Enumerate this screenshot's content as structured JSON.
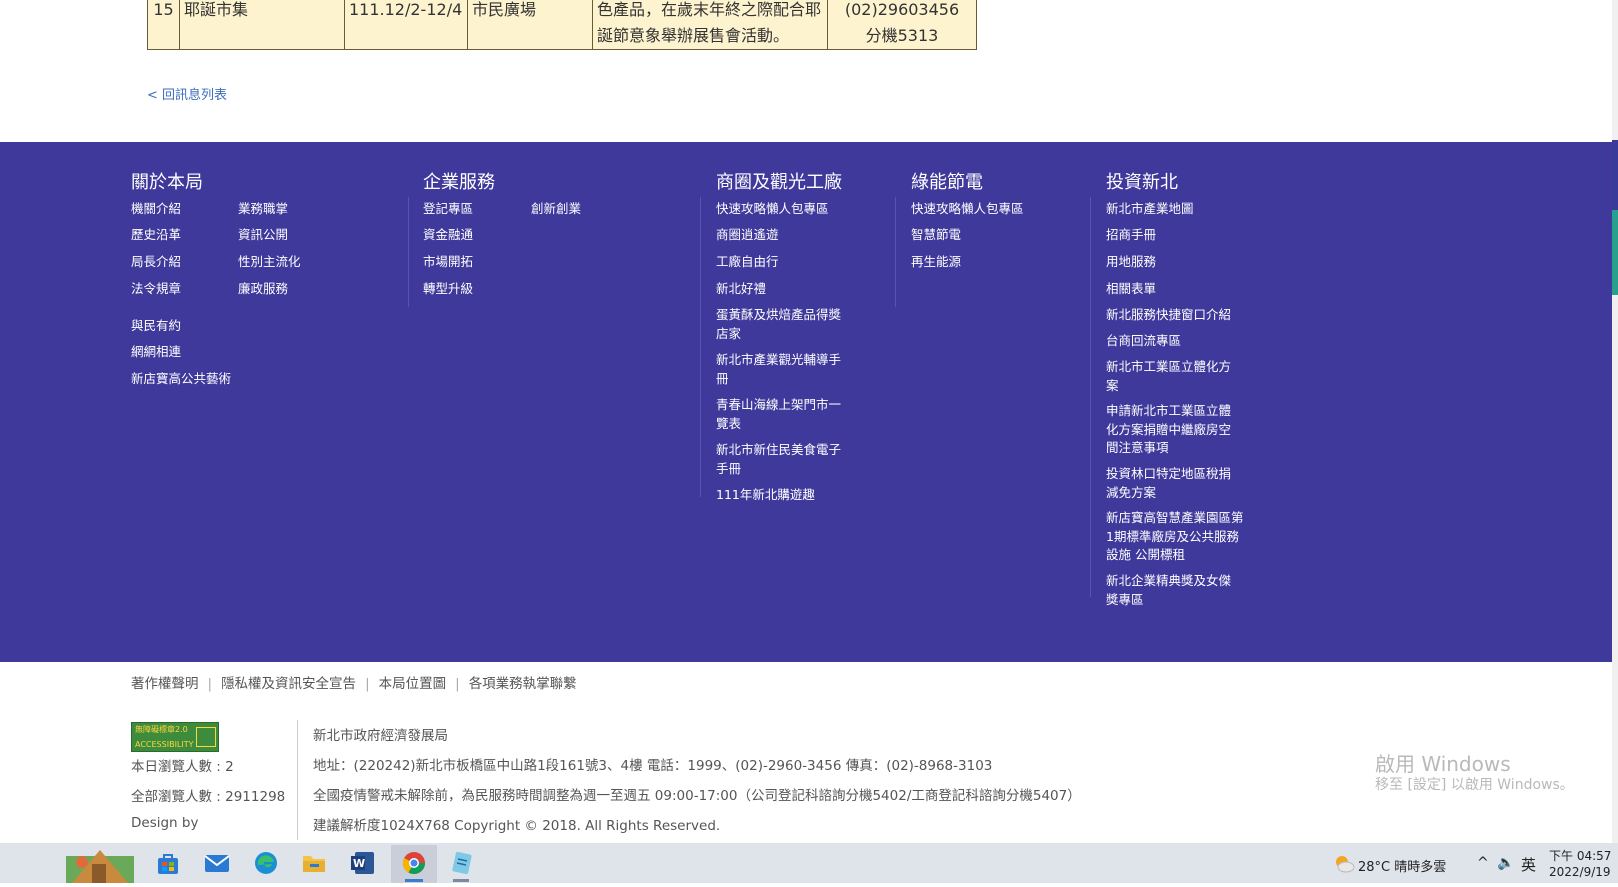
{
  "table": {
    "row": {
      "no": "15",
      "name": "耶誕市集",
      "date": "111.12/2-12/4",
      "place": "市民廣場",
      "desc_line1": "色產品，在歲末年終之際配合耶",
      "desc_line2": "誕節意象舉辦展售會活動。",
      "tel_line1": "(02)29603456",
      "tel_line2": "分機5313"
    }
  },
  "back_link": "< 回訊息列表",
  "footer": {
    "about": {
      "title": "關於本局",
      "col1": [
        "機關介紹",
        "歷史沿革",
        "局長介紹",
        "法令規章"
      ],
      "col2": [
        "業務職掌",
        "資訊公開",
        "性別主流化",
        "廉政服務"
      ],
      "extra": [
        "與民有約",
        "網網相連",
        "新店寶高公共藝術"
      ]
    },
    "enterprise": {
      "title": "企業服務",
      "col1": [
        "登記專區",
        "資金融通",
        "市場開拓",
        "轉型升級"
      ],
      "col2": [
        "創新創業"
      ]
    },
    "business": {
      "title": "商圈及觀光工廠",
      "items": [
        "快速攻略懶人包專區",
        "商圈逍遙遊",
        "工廠自由行",
        "新北好禮",
        "蛋黃酥及烘焙產品得獎店家",
        "新北市產業觀光輔導手冊",
        "青春山海線上架門市一覽表",
        "新北市新住民美食電子手冊",
        "111年新北購遊趣"
      ]
    },
    "green": {
      "title": "綠能節電",
      "items": [
        "快速攻略懶人包專區",
        "智慧節電",
        "再生能源"
      ]
    },
    "invest": {
      "title": "投資新北",
      "items": [
        "新北市產業地圖",
        "招商手冊",
        "用地服務",
        "相關表單",
        "新北服務快捷窗口介紹",
        "台商回流專區",
        "新北市工業區立體化方案",
        "申請新北市工業區立體化方案捐贈中繼廠房空間注意事項",
        "投資林口特定地區稅捐減免方案",
        "新店寶高智慧產業園區第1期標準廠房及公共服務設施 公開標租",
        "新北企業精典獎及女傑獎專區"
      ]
    }
  },
  "bottom_links": [
    "著作權聲明",
    "隱私權及資訊安全宣告",
    "本局位置圖",
    "各項業務執掌聯繫"
  ],
  "badge": {
    "line1": "無障礙標章2.0",
    "line2": "ACCESSIBILITY"
  },
  "stats": {
    "today": "本日瀏覽人數 : 2",
    "total": "全部瀏覽人數 : 2911298",
    "design": "Design by"
  },
  "info": {
    "org": "新北市政府經濟發展局",
    "address": "地址：(220242)新北市板橋區中山路1段161號3、4樓   電話：1999、(02)-2960-3456   傳真：(02)-8968-3103",
    "notice": "全國疫情警戒未解除前，為民服務時間調整為週一至週五 09:00-17:00（公司登記科諮詢分機5402/工商登記科諮詢分機5407）",
    "copyright": "建議解析度1024X768   Copyright © 2018. All Rights Reserved."
  },
  "watermark": {
    "title": "啟用 Windows",
    "sub": "移至 [設定] 以啟用 Windows。"
  },
  "taskbar": {
    "weather": "28°C  晴時多雲",
    "ime": "英",
    "time": "下午 04:57",
    "date": "2022/9/19",
    "colors": {
      "accent": "#3b7bd0",
      "footer": "#3f399c"
    }
  }
}
